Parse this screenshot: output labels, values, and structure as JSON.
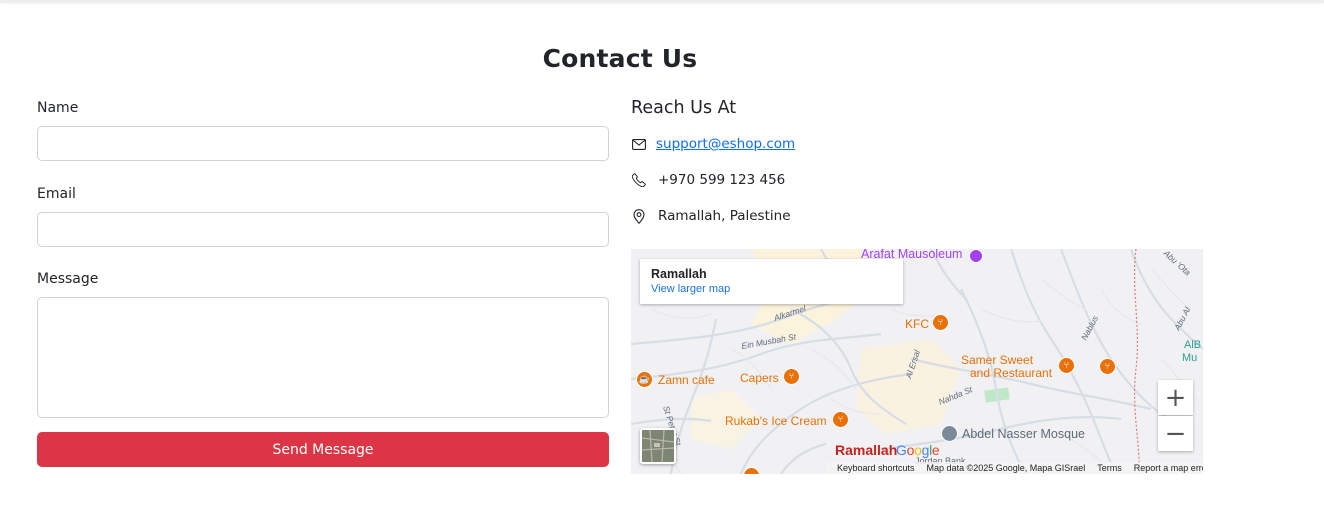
{
  "page": {
    "title": "Contact Us"
  },
  "form": {
    "name_label": "Name",
    "name_value": "",
    "email_label": "Email",
    "email_value": "",
    "message_label": "Message",
    "message_value": "",
    "submit_label": "Send Message"
  },
  "reach": {
    "heading": "Reach Us At",
    "email": "support@eshop.com",
    "phone": "+970 599 123 456",
    "location": "Ramallah, Palestine"
  },
  "map": {
    "place_name": "Ramallah",
    "view_larger": "View larger map",
    "labels": {
      "arafat": "Arafat Mausoleum",
      "alkarmel": "Alkarmel",
      "ein_musbah": "Ein Musbah St",
      "kfc": "KFC",
      "al_ersal": "Al Ersal",
      "nablus": "Nablus",
      "samer_sweet": "Samer Sweet",
      "and_restaurant": "and Restaurant",
      "abu_ayyash": "Abu Al",
      "albi": "AlB",
      "mun": "Mu",
      "abu_ota": "Abu 'Ota",
      "zamn_cafe": "Zamn cafe",
      "capers": "Capers",
      "nahda_st": "Nahda St",
      "st_peter_st": "St Peter St",
      "rukabs": "Rukab's Ice Cream",
      "abdel_nasser": "Abdel Nasser Mosque",
      "ramallah_city": "Ramallah",
      "jordan_bank": "Jordan Bank"
    },
    "zoom_in": "+",
    "zoom_out": "−",
    "google_letters": [
      "G",
      "o",
      "o",
      "g",
      "l",
      "e"
    ],
    "attribution": {
      "keyboard": "Keyboard shortcuts",
      "map_data": "Map data ©2025 Google, Mapa GISrael",
      "terms": "Terms",
      "report": "Report a map error"
    }
  },
  "colors": {
    "primary_button": "#dc3545",
    "link": "#0d6efd",
    "map_poi_orange": "#e8710a",
    "map_poi_purple": "#a142f4",
    "map_link": "#1a73e8",
    "map_city_red": "#c5221f"
  },
  "icons": {
    "email": "envelope-icon",
    "phone": "telephone-icon",
    "location": "map-pin-icon"
  }
}
